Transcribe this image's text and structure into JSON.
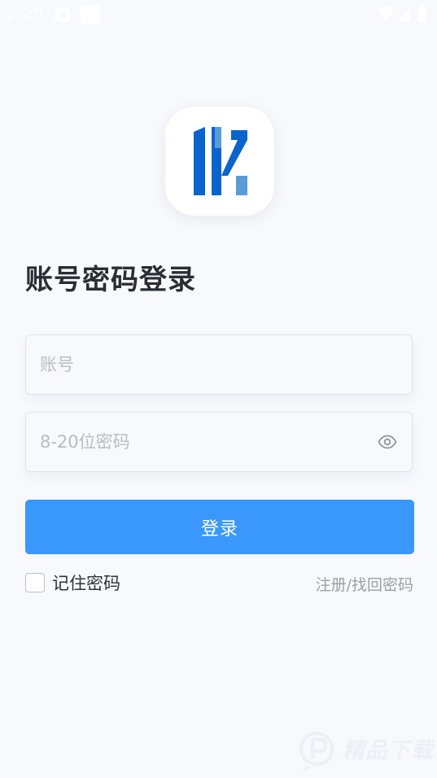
{
  "status_bar": {
    "time": "2:25",
    "icons": [
      "notification-icon",
      "notification-icon",
      "wifi-icon",
      "cellular-signal-icon",
      "battery-icon"
    ]
  },
  "logo": {
    "icon": "app-logo-icon",
    "colors": {
      "primary": "#0b63ce",
      "secondary": "#5b9bd8"
    }
  },
  "page": {
    "title": "账号密码登录"
  },
  "form": {
    "account": {
      "placeholder": "账号",
      "value": ""
    },
    "password": {
      "placeholder": "8-20位密码",
      "value": "",
      "toggle_icon": "eye-icon"
    },
    "login_label": "登录",
    "remember_label": "记住密码",
    "remember_checked": false,
    "register_link": "注册/找回密码"
  },
  "watermark": {
    "text": "精品下载"
  },
  "colors": {
    "accent": "#3a98fc",
    "background": "#f7f9fc",
    "title_text": "#2a2d33",
    "placeholder": "#b7bcc4"
  }
}
